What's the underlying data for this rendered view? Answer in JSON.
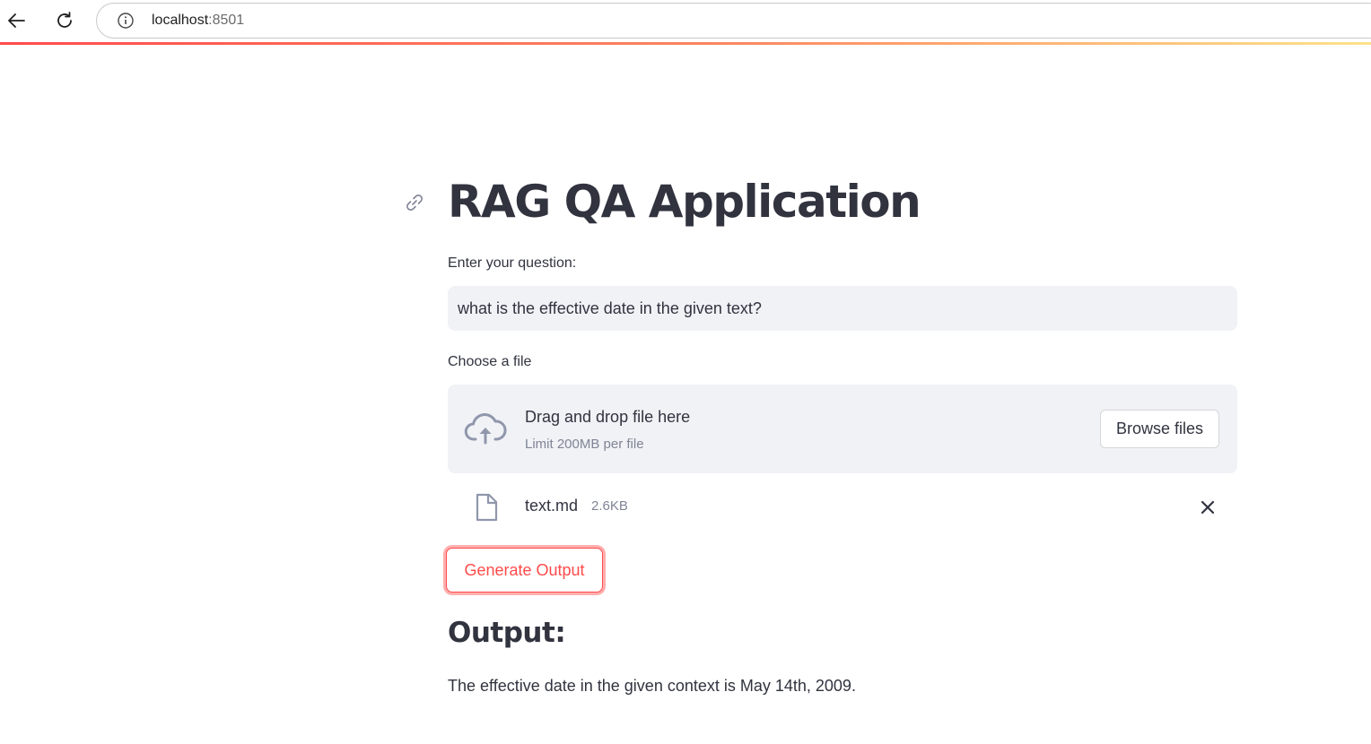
{
  "browser": {
    "url_host": "localhost",
    "url_port": ":8501"
  },
  "main": {
    "title": "RAG QA Application",
    "question_label": "Enter your question:",
    "question_value": "what is the effective date in the given text?",
    "file_label": "Choose a file",
    "dropzone_title": "Drag and drop file here",
    "dropzone_limit": "Limit 200MB per file",
    "browse_label": "Browse files",
    "uploaded_file": {
      "name": "text.md",
      "size": "2.6KB"
    },
    "generate_label": "Generate Output",
    "output_heading": "Output:",
    "output_text": "The effective date in the given context is May 14th, 2009."
  },
  "colors": {
    "primary": "#ff4b4b",
    "text": "#31333f",
    "input_bg": "#f0f2f6",
    "muted": "#808495"
  },
  "icons": [
    "back-arrow-icon",
    "reload-icon",
    "info-icon",
    "link-icon",
    "cloud-upload-icon",
    "file-icon",
    "close-icon"
  ]
}
